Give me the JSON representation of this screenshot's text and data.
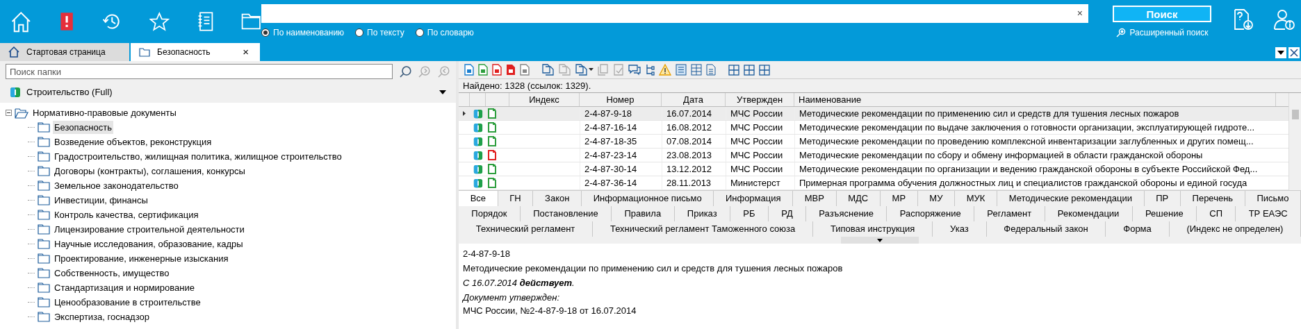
{
  "search": {
    "radios": [
      {
        "label": "По наименованию",
        "selected": true
      },
      {
        "label": "По тексту",
        "selected": false
      },
      {
        "label": "По словарю",
        "selected": false
      }
    ],
    "clear": "×",
    "button": "Поиск",
    "advanced": "Расширенный поиск"
  },
  "window_tabs": [
    {
      "label": "Стартовая страница",
      "selected": false,
      "closable": false
    },
    {
      "label": "Безопасность",
      "selected": true,
      "closable": true,
      "close": "×"
    }
  ],
  "sidebar": {
    "search_placeholder": "Поиск папки",
    "collection": "Строительство (Full)",
    "tree": [
      {
        "label": "Нормативно-правовые документы",
        "expanded": true,
        "selected": false,
        "children": [
          {
            "label": "Безопасность",
            "selected": true
          },
          {
            "label": "Возведение объектов, реконструкция",
            "selected": false
          },
          {
            "label": "Градостроительство, жилищная политика, жилищное строительство",
            "selected": false
          },
          {
            "label": "Договоры (контракты), соглашения, конкурсы",
            "selected": false
          },
          {
            "label": "Земельное законодательство",
            "selected": false
          },
          {
            "label": "Инвестиции, финансы",
            "selected": false
          },
          {
            "label": "Контроль качества, сертификация",
            "selected": false
          },
          {
            "label": "Лицензирование строительной деятельности",
            "selected": false
          },
          {
            "label": "Научные исследования, образование, кадры",
            "selected": false
          },
          {
            "label": "Проектирование, инженерные изыскания",
            "selected": false
          },
          {
            "label": "Собственность, имущество",
            "selected": false
          },
          {
            "label": "Стандартизация и нормирование",
            "selected": false
          },
          {
            "label": "Ценообразование в строительстве",
            "selected": false
          },
          {
            "label": "Экспертиза, госнадзор",
            "selected": false
          }
        ]
      }
    ]
  },
  "found": "Найдено: 1328 (ссылок: 1329).",
  "table": {
    "columns": [
      "Индекс",
      "Номер",
      "Дата",
      "Утвержден",
      "Наименование"
    ],
    "rows": [
      {
        "selected": true,
        "color": "#2e9e3e",
        "cells": [
          "",
          "2-4-87-9-18",
          "16.07.2014",
          "МЧС России",
          "Методические рекомендации по применению сил и средств для тушения лесных пожаров"
        ]
      },
      {
        "selected": false,
        "color": "#2e9e3e",
        "cells": [
          "",
          "2-4-87-16-14",
          "16.08.2012",
          "МЧС России",
          "Методические рекомендации по выдаче заключения о готовности организации, эксплуатирующей гидроте..."
        ]
      },
      {
        "selected": false,
        "color": "#2e9e3e",
        "cells": [
          "",
          "2-4-87-18-35",
          "07.08.2014",
          "МЧС России",
          "Методические рекомендации по проведению комплексной инвентаризации заглубленных и других помещ..."
        ]
      },
      {
        "selected": false,
        "color": "#e02020",
        "cells": [
          "",
          "2-4-87-23-14",
          "23.08.2013",
          "МЧС России",
          "Методические рекомендации по сбору и обмену информацией в области гражданской обороны"
        ]
      },
      {
        "selected": false,
        "color": "#2e9e3e",
        "cells": [
          "",
          "2-4-87-30-14",
          "13.12.2012",
          "МЧС России",
          "Методические рекомендации по организации и ведению гражданской обороны в субъекте Российской Фед..."
        ]
      },
      {
        "selected": false,
        "color": "#2e9e3e",
        "cells": [
          "",
          "2-4-87-36-14",
          "28.11.2013",
          "Министерст",
          "Примерная программа обучения должностных лиц и специалистов гражданской обороны и единой госуда"
        ]
      }
    ]
  },
  "filter_tabs": [
    [
      {
        "label": "Все",
        "selected": true
      },
      {
        "label": "ГН",
        "selected": false
      },
      {
        "label": "Закон",
        "selected": false
      },
      {
        "label": "Информационное письмо",
        "selected": false
      },
      {
        "label": "Информация",
        "selected": false
      },
      {
        "label": "МВР",
        "selected": false
      },
      {
        "label": "МДС",
        "selected": false
      },
      {
        "label": "МР",
        "selected": false
      },
      {
        "label": "МУ",
        "selected": false
      },
      {
        "label": "МУК",
        "selected": false
      },
      {
        "label": "Методические рекомендации",
        "selected": false
      },
      {
        "label": "ПР",
        "selected": false
      },
      {
        "label": "Перечень",
        "selected": false
      },
      {
        "label": "Письмо",
        "selected": false
      }
    ],
    [
      {
        "label": "Порядок",
        "selected": false
      },
      {
        "label": "Постановление",
        "selected": false
      },
      {
        "label": "Правила",
        "selected": false
      },
      {
        "label": "Приказ",
        "selected": false
      },
      {
        "label": "РБ",
        "selected": false
      },
      {
        "label": "РД",
        "selected": false
      },
      {
        "label": "Разъяснение",
        "selected": false
      },
      {
        "label": "Распоряжение",
        "selected": false
      },
      {
        "label": "Регламент",
        "selected": false
      },
      {
        "label": "Рекомендации",
        "selected": false
      },
      {
        "label": "Решение",
        "selected": false
      },
      {
        "label": "СП",
        "selected": false
      },
      {
        "label": "ТР ЕАЭС",
        "selected": false
      }
    ],
    [
      {
        "label": "Технический регламент",
        "selected": false
      },
      {
        "label": "Технический регламент Таможенного союза",
        "selected": false
      },
      {
        "label": "Типовая инструкция",
        "selected": false
      },
      {
        "label": "Указ",
        "selected": false
      },
      {
        "label": "Федеральный закон",
        "selected": false
      },
      {
        "label": "Форма",
        "selected": false
      },
      {
        "label": "(Индекс не определен)",
        "selected": false
      }
    ]
  ],
  "detail": {
    "number": "2-4-87-9-18",
    "title": "Методические рекомендации по применению сил и средств для тушения лесных пожаров",
    "status": "С 16.07.2014 **действует**.",
    "approved_label": "Документ утвержден:",
    "approved_by": "МЧС России, №2-4-87-9-18 от 16.07.2014"
  }
}
